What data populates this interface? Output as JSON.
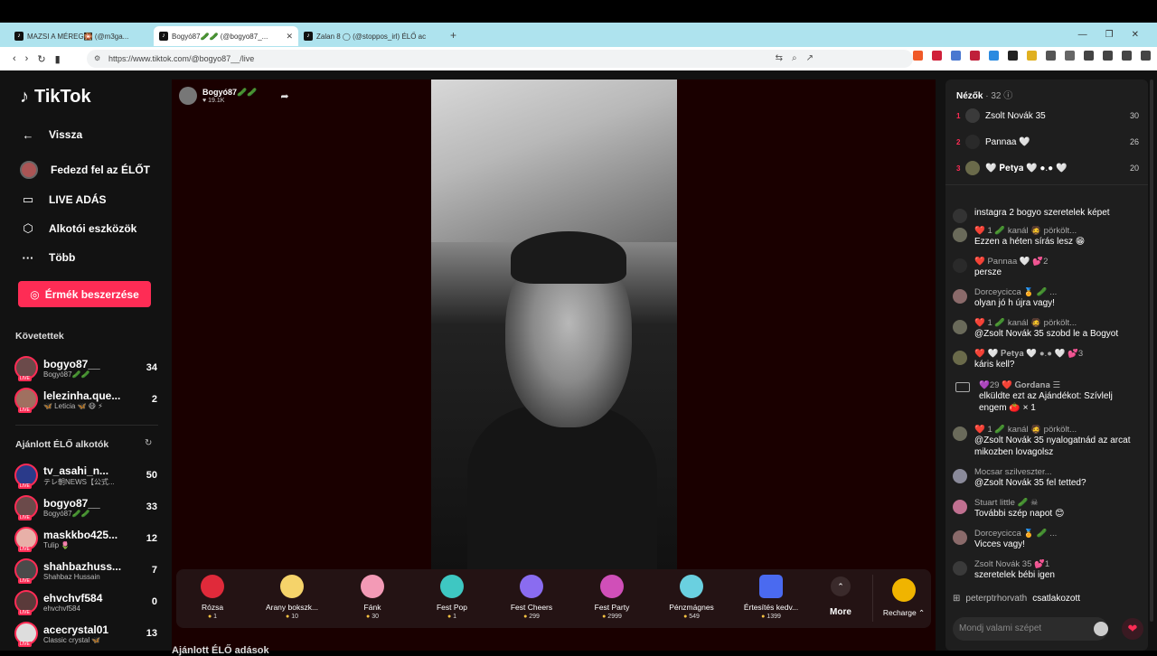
{
  "browser": {
    "tabs": [
      {
        "title": "MAZSI A MÉREG🎇 (@m3ga...",
        "active": false
      },
      {
        "title": "Bogyó87🥒🥒 (@bogyo87_...",
        "active": true
      },
      {
        "title": "Zalan 8 ◯ (@stoppos_irl) ÉLŐ ac",
        "active": false
      }
    ],
    "url": "https://www.tiktok.com/@bogyo87__/live"
  },
  "sidebar": {
    "logo": "TikTok",
    "nav": [
      {
        "label": "Vissza",
        "icon": "arrow-left-icon"
      },
      {
        "label": "Fedezd fel az ÉLŐT",
        "icon": "avatar-icon"
      },
      {
        "label": "LIVE ADÁS",
        "icon": "video-camera-icon"
      },
      {
        "label": "Alkotói eszközök",
        "icon": "creator-tools-icon"
      },
      {
        "label": "Több",
        "icon": "more-dots-icon"
      }
    ],
    "coins_button": "Érmék beszerzése",
    "following_title": "Követettek",
    "following": [
      {
        "name": "bogyo87__",
        "sub": "Bogyó87🥒🥒",
        "count": "34"
      },
      {
        "name": "lelezinha.que...",
        "sub": "🦋 Leticia 🦋 😷 ⚡",
        "count": "2"
      }
    ],
    "recommended_title": "Ajánlott ÉLŐ alkotók",
    "recommended": [
      {
        "name": "tv_asahi_n...",
        "sub": "テレ朝NEWS【公式...",
        "count": "50"
      },
      {
        "name": "bogyo87__",
        "sub": "Bogyó87🥒🥒",
        "count": "33"
      },
      {
        "name": "maskkbo425...",
        "sub": "Tulip 🌷",
        "count": "12"
      },
      {
        "name": "shahbazhuss...",
        "sub": "Shahbaz Hussain",
        "count": "7"
      },
      {
        "name": "ehvchvf584",
        "sub": "ehvchvf584",
        "count": "0"
      },
      {
        "name": "acecrystal01",
        "sub": "Classic crystal 🦋",
        "count": "13"
      }
    ]
  },
  "stream": {
    "streamer_name": "Bogyó87🥒🥒",
    "likes": "♥ 19.1K",
    "gifts": [
      {
        "name": "Rózsa",
        "price": "1",
        "color": "#e02a3a"
      },
      {
        "name": "Arany bokszk...",
        "price": "10",
        "color": "#f5d36a"
      },
      {
        "name": "Fánk",
        "price": "30",
        "color": "#f39ab6"
      },
      {
        "name": "Fest Pop",
        "price": "1",
        "color": "#3ec7c2"
      },
      {
        "name": "Fest Cheers",
        "price": "299",
        "color": "#8a6cf0"
      },
      {
        "name": "Fest Party",
        "price": "2999",
        "color": "#d04fb8"
      },
      {
        "name": "Pénzmágnes",
        "price": "549",
        "color": "#6ad0e0"
      },
      {
        "name": "Értesítés kedv...",
        "price": "1399",
        "color": "#4a6af0"
      }
    ],
    "more_label": "More",
    "recharge_label": "Recharge ⌃",
    "below_title": "Ajánlott ÉLŐ adások"
  },
  "chat": {
    "viewers_label": "Nézők",
    "viewers_count": "· 32",
    "top_viewers": [
      {
        "rank": "1",
        "name": "Zsolt Novák 35",
        "score": "30"
      },
      {
        "rank": "2",
        "name": "Pannaa 🤍",
        "score": "26"
      },
      {
        "rank": "3",
        "name": "🤍 𝐏𝐞𝐭𝐲𝐚 🤍 ●.● 🤍",
        "score": "20"
      }
    ],
    "messages": [
      {
        "user": "",
        "text": "instagra 2 bogyo szeretelek képet"
      },
      {
        "user": "❤️ 1 🥒 kanál 🧔 pörkölt...",
        "text": "Ezzen a héten sírás lesz 😁"
      },
      {
        "user": "❤️ Pannaa 🤍 💕2",
        "text": "persze"
      },
      {
        "user": "Dorceycicca 🏅 🥒 ...",
        "text": "olyan jó h újra vagy!"
      },
      {
        "user": "❤️ 1 🥒 kanál 🧔 pörkölt...",
        "text": "@Zsolt Novák 35 szobd le a Bogyot"
      },
      {
        "user": "❤️ 🤍 𝐏𝐞𝐭𝐲𝐚 🤍 ●.● 🤍 💕3",
        "text": "káris kell?"
      },
      {
        "user": "💜29 ❤️ 𝐆𝐨𝐫𝐝𝐚𝐧𝐚 ☰",
        "text": "elküldte ezt az Ajándékot:  Szívlelj engem 🍅 × 1"
      },
      {
        "user": "❤️ 1 🥒 kanál 🧔 pörkölt...",
        "text": "@Zsolt Novák 35 nyalogatnád az arcat mikozben lovagolsz"
      },
      {
        "user": "Mocsar szilveszter...",
        "text": "@Zsolt Novák 35 fel tetted?"
      },
      {
        "user": "Stuart little 🥒 ☠",
        "text": "További szép napot 😊"
      },
      {
        "user": "Dorceycicca 🏅 🥒 ...",
        "text": "Vicces vagy!"
      },
      {
        "user": "Zsolt Novák 35 💕1",
        "text": "szeretelek bébi igen"
      }
    ],
    "joined_user": "peterptrhorvath",
    "joined_text": "csatlakozott",
    "input_placeholder": "Mondj valami szépet"
  }
}
